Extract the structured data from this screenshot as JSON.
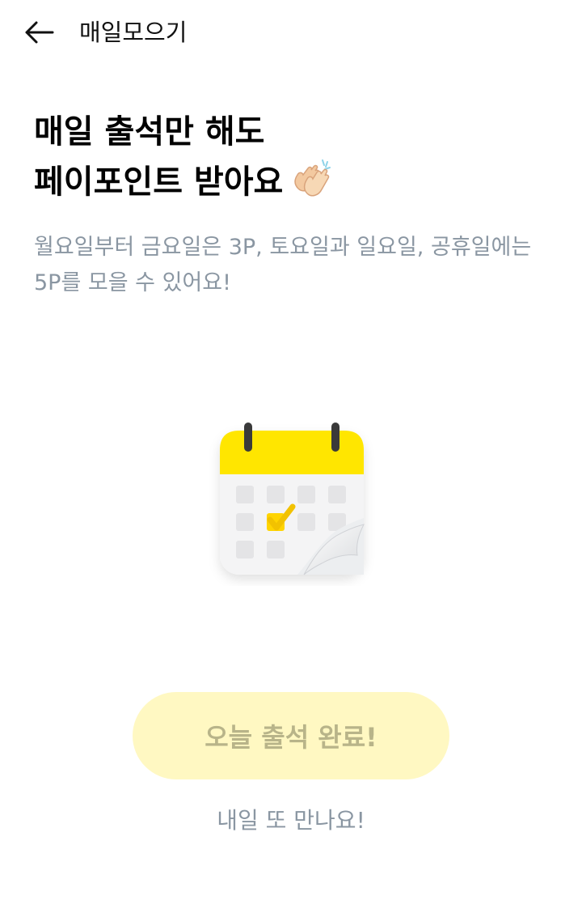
{
  "header": {
    "back_icon": "arrow-left-icon",
    "title": "매일모으기"
  },
  "hero": {
    "headline_line1": "매일 출석만 해도",
    "headline_line2": "페이포인트 받아요",
    "headline_icon": "clapping-hands-icon",
    "description": "월요일부터 금요일은 3P, 토요일과 일요일, 공휴일에는 5P를 모을 수 있어요!"
  },
  "illustration": {
    "icon": "calendar-check-icon",
    "accent": "#ffe600"
  },
  "actions": {
    "primary_label": "오늘 출석 완료!",
    "primary_disabled": true,
    "primary_bg": "#fff8c2",
    "primary_text_color": "#b8b489",
    "sub_message": "내일 또 만나요!"
  }
}
